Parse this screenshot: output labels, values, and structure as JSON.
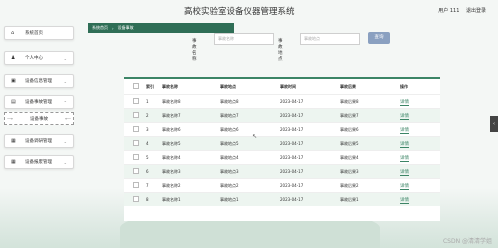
{
  "header": {
    "title": "高校实验室设备仪器管理系统",
    "user_label": "用户 111",
    "logout_label": "退出登录"
  },
  "sidebar": {
    "items": [
      {
        "label": "系统首页",
        "icon": "home-icon"
      },
      {
        "label": "个人中心",
        "icon": "user-icon"
      },
      {
        "label": "设备信息管理",
        "icon": "lock-icon"
      },
      {
        "label": "设备事故管理",
        "icon": "image-icon"
      },
      {
        "label": "设备事故",
        "icon": ""
      },
      {
        "label": "设备调研管理",
        "icon": "grid-icon"
      },
      {
        "label": "设备报废管理",
        "icon": "grid-icon"
      }
    ]
  },
  "breadcrumb": {
    "home": "系统首页",
    "current": "设备事故"
  },
  "search": {
    "name_label": "事故名称",
    "name_placeholder": "事故名称",
    "place_label": "事故地点",
    "place_placeholder": "事故地点",
    "button": "查询"
  },
  "table": {
    "columns": [
      "索引",
      "事故名称",
      "事故地点",
      "事故时间",
      "事故后果",
      "操作"
    ],
    "rows": [
      {
        "index": "1",
        "name": "事故名称8",
        "place": "事故地点8",
        "time": "2023-04-17",
        "result": "事故后果8",
        "action": "详情"
      },
      {
        "index": "2",
        "name": "事故名称7",
        "place": "事故地点7",
        "time": "2023-04-17",
        "result": "事故后果7",
        "action": "详情"
      },
      {
        "index": "3",
        "name": "事故名称6",
        "place": "事故地点6",
        "time": "2023-04-17",
        "result": "事故后果6",
        "action": "详情"
      },
      {
        "index": "4",
        "name": "事故名称5",
        "place": "事故地点5",
        "time": "2023-04-17",
        "result": "事故后果5",
        "action": "详情"
      },
      {
        "index": "5",
        "name": "事故名称4",
        "place": "事故地点4",
        "time": "2023-04-17",
        "result": "事故后果4",
        "action": "详情"
      },
      {
        "index": "6",
        "name": "事故名称3",
        "place": "事故地点3",
        "time": "2023-04-17",
        "result": "事故后果3",
        "action": "详情"
      },
      {
        "index": "7",
        "name": "事故名称2",
        "place": "事故地点2",
        "time": "2023-04-17",
        "result": "事故后果2",
        "action": "详情"
      },
      {
        "index": "8",
        "name": "事故名称1",
        "place": "事故地点1",
        "time": "2023-04-17",
        "result": "事故后果1",
        "action": "详情"
      }
    ]
  },
  "watermark": "CSDN @清清学姐",
  "side_tab": "‹",
  "colors": {
    "accent": "#3c8566",
    "crumb": "#2f6e56",
    "button": "#8aa0c0"
  }
}
